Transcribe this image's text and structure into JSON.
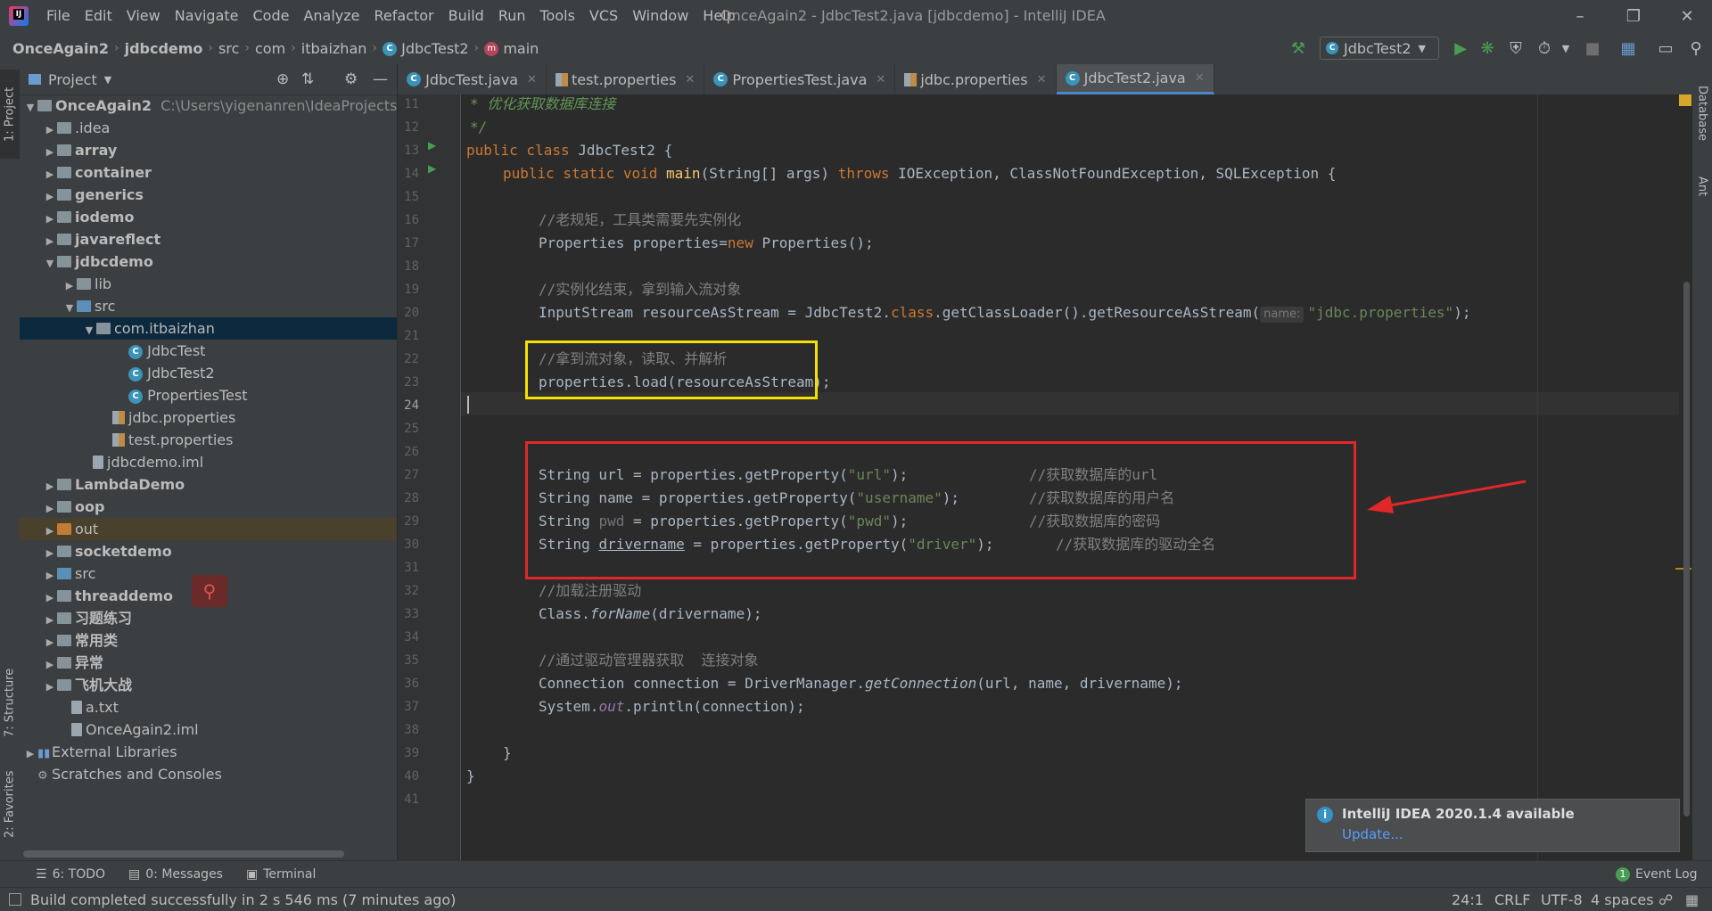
{
  "window": {
    "title": "OnceAgain2 - JdbcTest2.java [jdbcdemo] - IntelliJ IDEA",
    "menu": [
      "File",
      "Edit",
      "View",
      "Navigate",
      "Code",
      "Analyze",
      "Refactor",
      "Build",
      "Run",
      "Tools",
      "VCS",
      "Window",
      "Help"
    ]
  },
  "breadcrumbs": [
    "OnceAgain2",
    "jdbcdemo",
    "src",
    "com",
    "itbaizhan",
    "JdbcTest2",
    "main"
  ],
  "toolbar": {
    "run_config": "JdbcTest2"
  },
  "project_panel": {
    "title": "Project",
    "tree": [
      {
        "label": "OnceAgain2",
        "path": "C:\\Users\\yigenanren\\IdeaProjects\\On",
        "bold": true
      },
      {
        "label": ".idea"
      },
      {
        "label": "array",
        "bold": true
      },
      {
        "label": "container",
        "bold": true
      },
      {
        "label": "generics",
        "bold": true
      },
      {
        "label": "iodemo",
        "bold": true
      },
      {
        "label": "javareflect",
        "bold": true
      },
      {
        "label": "jdbcdemo",
        "bold": true
      },
      {
        "label": "lib"
      },
      {
        "label": "src"
      },
      {
        "label": "com.itbaizhan"
      },
      {
        "label": "JdbcTest"
      },
      {
        "label": "JdbcTest2"
      },
      {
        "label": "PropertiesTest"
      },
      {
        "label": "jdbc.properties"
      },
      {
        "label": "test.properties"
      },
      {
        "label": "jdbcdemo.iml"
      },
      {
        "label": "LambdaDemo",
        "bold": true
      },
      {
        "label": "oop",
        "bold": true
      },
      {
        "label": "out"
      },
      {
        "label": "socketdemo",
        "bold": true
      },
      {
        "label": "src"
      },
      {
        "label": "threaddemo",
        "bold": true
      },
      {
        "label": "习题练习",
        "bold": true
      },
      {
        "label": "常用类",
        "bold": true
      },
      {
        "label": "异常",
        "bold": true
      },
      {
        "label": "飞机大战",
        "bold": true
      },
      {
        "label": "a.txt"
      },
      {
        "label": "OnceAgain2.iml"
      },
      {
        "label": "External Libraries"
      },
      {
        "label": "Scratches and Consoles"
      }
    ]
  },
  "left_strip": {
    "project": "1: Project",
    "structure": "7: Structure",
    "favorites": "2: Favorites"
  },
  "right_strip": {
    "database": "Database",
    "ant": "Ant"
  },
  "editor_tabs": [
    "JdbcTest.java",
    "test.properties",
    "PropertiesTest.java",
    "jdbc.properties",
    "JdbcTest2.java"
  ],
  "active_tab": "JdbcTest2.java",
  "code": {
    "first_line": 11,
    "lines": {
      "l11": "* 优化获取数据库连接",
      "l12": "*/",
      "l13_kw": "public class ",
      "l13_name": "JdbcTest2 {",
      "l14_kw": "public static void ",
      "l14_fn": "main",
      "l14_a": "(String[] args) ",
      "l14_kw2": "throws ",
      "l14_b": "IOException, ClassNotFoundException, SQLException {",
      "l16": "//老规矩，工具类需要先实例化",
      "l17_a": "Properties properties=",
      "l17_kw": "new ",
      "l17_b": "Properties();",
      "l19": "//实例化结束，拿到输入流对象",
      "l20_a": "InputStream resourceAsStream = JdbcTest2.",
      "l20_kw": "class",
      "l20_b": ".getClassLoader().getResourceAsStream(",
      "l20_hint": "name:",
      "l20_str": "\"jdbc.properties\"",
      "l20_c": ");",
      "l22": "//拿到流对象，读取、并解析",
      "l23": "properties.load(resourceAsStream);",
      "l27_a": "String url = properties.getProperty(",
      "l27_str": "\"url\"",
      "l27_b": ");",
      "l27_cm": "//获取数据库的url",
      "l28_a": "String name = properties.getProperty(",
      "l28_str": "\"username\"",
      "l28_b": ");",
      "l28_cm": "//获取数据库的用户名",
      "l29_a": "String ",
      "l29_var": "pwd",
      "l29_b": " = properties.getProperty(",
      "l29_str": "\"pwd\"",
      "l29_c": ");",
      "l29_cm": "//获取数据库的密码",
      "l30_a": "String ",
      "l30_var": "drivername",
      "l30_b": " = properties.getProperty(",
      "l30_str": "\"driver\"",
      "l30_c": ");",
      "l30_cm": "//获取数据库的驱动全名",
      "l32": "//加载注册驱动",
      "l33_a": "Class.",
      "l33_it": "forName",
      "l33_b": "(drivername);",
      "l35": "//通过驱动管理器获取  连接对象",
      "l36_a": "Connection connection = DriverManager.",
      "l36_it": "getConnection",
      "l36_b": "(url, name, drivername);",
      "l37_a": "System.",
      "l37_st": "out",
      "l37_b": ".println(connection);",
      "l39": "}",
      "l40": "}"
    }
  },
  "notification": {
    "title": "IntelliJ IDEA 2020.1.4 available",
    "link": "Update..."
  },
  "bottom_tabs": {
    "todo": "6: TODO",
    "messages": "0: Messages",
    "terminal": "Terminal",
    "event_log": "Event Log",
    "event_count": "1"
  },
  "status": {
    "message": "Build completed successfully in 2 s 546 ms (7 minutes ago)",
    "position": "24:1",
    "line_sep": "CRLF",
    "encoding": "UTF-8",
    "indent": "4 spaces"
  },
  "colors": {
    "annot_yellow": "#f5e100",
    "annot_red": "#e02828",
    "accent": "#4a88c7"
  }
}
